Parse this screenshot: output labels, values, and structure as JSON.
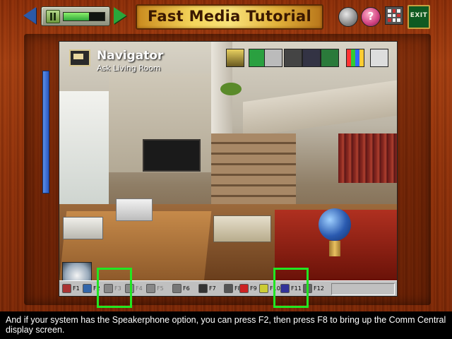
{
  "header": {
    "title": "Fast Media Tutorial",
    "progress": 0.62,
    "back_icon": "left-arrow-icon",
    "forward_icon": "right-arrow-icon",
    "pause_icon": "pause-icon",
    "help_label": "?",
    "exit_label": "EXIT"
  },
  "navigator": {
    "title": "Navigator",
    "subtitle": "Ask Living Room"
  },
  "taskbar": {
    "keys": [
      {
        "label": "F1",
        "dim": false
      },
      {
        "label": "F2",
        "dim": false
      },
      {
        "label": "F3",
        "dim": true
      },
      {
        "label": "F4",
        "dim": true
      },
      {
        "label": "F5",
        "dim": true
      },
      {
        "label": "F6",
        "dim": false
      },
      {
        "label": "F7",
        "dim": false
      },
      {
        "label": "F8",
        "dim": false
      },
      {
        "label": "F9",
        "dim": false
      },
      {
        "label": "F10",
        "dim": false
      },
      {
        "label": "F11",
        "dim": false
      },
      {
        "label": "F12",
        "dim": false
      }
    ]
  },
  "caption": "And if your system has the Speakerphone option, you can press F2, then press F8 to bring up the Comm Central display screen.",
  "colors": {
    "highlight": "#22e622",
    "wood": "#8a2c08",
    "title_plate": "#f4d55a"
  }
}
